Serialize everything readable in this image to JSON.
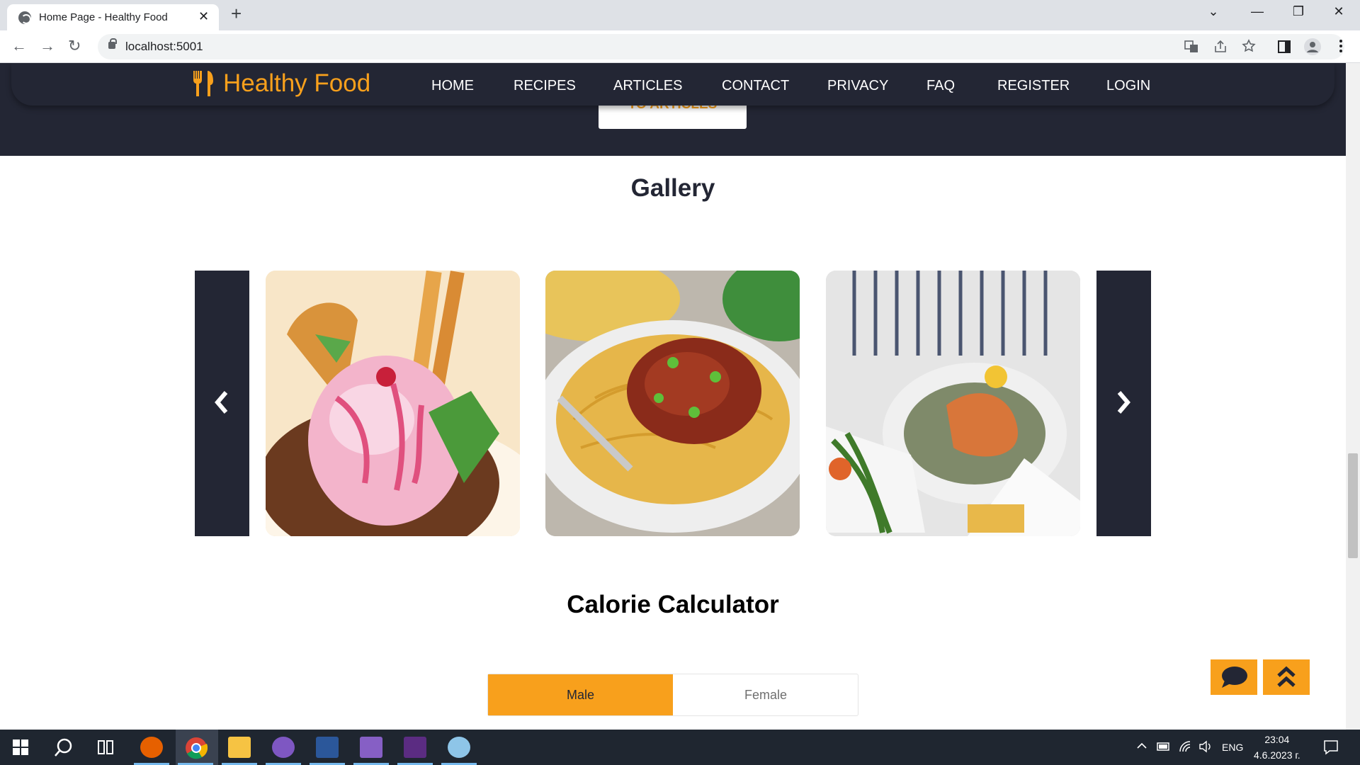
{
  "browser": {
    "tab_title": "Home Page - Healthy Food",
    "tab_close": "✕",
    "new_tab": "+",
    "url": "localhost:5001",
    "window_controls": {
      "collapse": "⌄",
      "minimize": "—",
      "restore": "❐",
      "close": "✕"
    },
    "nav": {
      "back": "←",
      "forward": "→",
      "reload": "↻"
    },
    "toolbar_icons": [
      "translate-icon",
      "share-icon",
      "star-icon",
      "sidebar-icon",
      "profile-icon",
      "menu-icon"
    ]
  },
  "site": {
    "logo_text": "Healthy Food",
    "nav_items": [
      "HOME",
      "RECIPES",
      "ARTICLES",
      "CONTACT",
      "PRIVACY",
      "FAQ",
      "REGISTER",
      "LOGIN"
    ],
    "hero_button": "TO ARTICLES",
    "gallery_title": "Gallery",
    "gallery_images": [
      "ice-cream-dessert",
      "spaghetti-bolognese",
      "salmon-with-green-beans"
    ],
    "calc_title": "Calorie Calculator",
    "gender_options": [
      "Male",
      "Female"
    ],
    "selected_gender": "Male",
    "accent_color": "#f8a01c",
    "dark_color": "#232634"
  },
  "taskbar": {
    "lang": "ENG",
    "time": "23:04",
    "date": "4.6.2023 г."
  }
}
